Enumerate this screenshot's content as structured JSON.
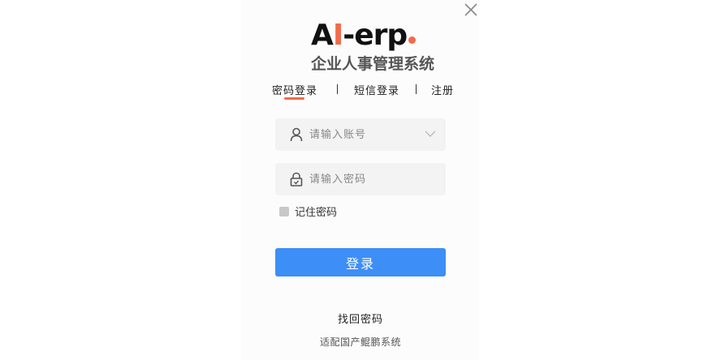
{
  "logo": {
    "part1": "A",
    "part2": "I",
    "part3": "-erp",
    "accent_color": "#f26b4a"
  },
  "app": {
    "subtitle": "企业人事管理系统"
  },
  "tabs": [
    {
      "label": "密码登录",
      "active": true
    },
    {
      "label": "短信登录",
      "active": false
    },
    {
      "label": "注册",
      "active": false
    }
  ],
  "form": {
    "account_placeholder": "请输入账号",
    "account_value": "",
    "password_placeholder": "请输入密码",
    "password_value": "",
    "remember_label": "记住密码",
    "remember_checked": false,
    "login_label": "登录"
  },
  "links": {
    "forgot_password": "找回密码"
  },
  "footer": {
    "text": "适配国产鲲鹏系统"
  },
  "icons": {
    "close": "close-icon",
    "user": "user-icon",
    "lock": "lock-icon",
    "dropdown": "chevron-down-icon"
  },
  "colors": {
    "primary": "#3e8ef7",
    "accent": "#f26b4a",
    "panel_bg": "#fcfcfc",
    "field_bg": "#f3f3f3"
  }
}
